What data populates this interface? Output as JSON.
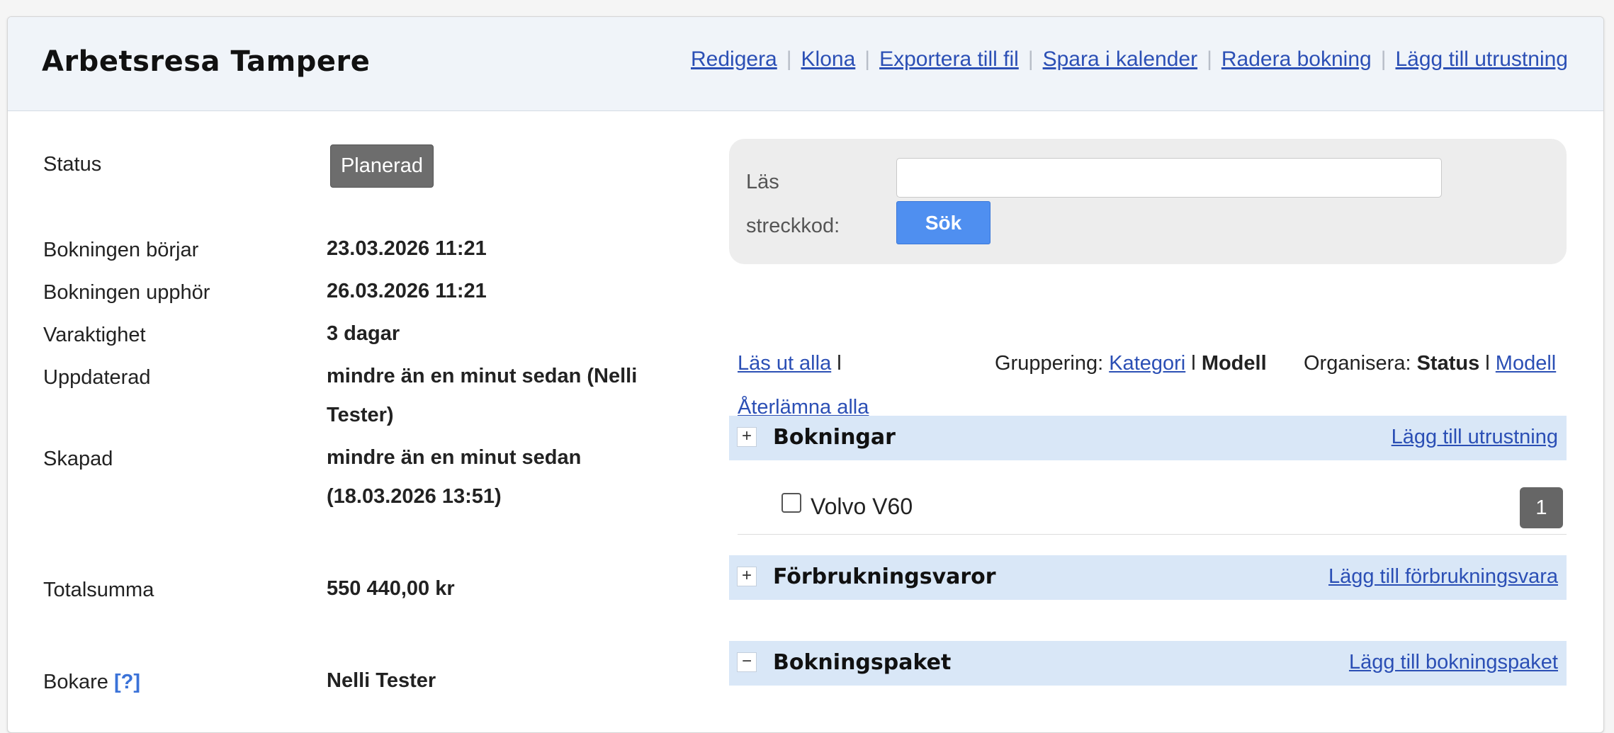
{
  "header": {
    "title": "Arbetsresa Tampere",
    "actions": [
      "Redigera",
      "Klona",
      "Exportera till fil",
      "Spara i kalender",
      "Radera bokning",
      "Lägg till utrustning"
    ]
  },
  "details": {
    "status_label": "Status",
    "status_value": "Planerad",
    "start_label": "Bokningen börjar",
    "start_value": "23.03.2026 11:21",
    "end_label": "Bokningen upphör",
    "end_value": "26.03.2026 11:21",
    "duration_label": "Varaktighet",
    "duration_value": "3 dagar",
    "updated_label": "Uppdaterad",
    "updated_value_line1": "mindre än en minut sedan (Nelli",
    "updated_value_line2": "Tester)",
    "created_label": "Skapad",
    "created_value_line1": "mindre än en minut sedan",
    "created_value_line2": "(18.03.2026 13:51)",
    "total_label": "Totalsumma",
    "total_value": "550 440,00 kr",
    "booker_label": "Bokare",
    "booker_help": "[?]",
    "booker_value": "Nelli Tester"
  },
  "search": {
    "label_line1": "Läs",
    "label_line2": "streckkod:",
    "input_value": "",
    "button_label": "Sök"
  },
  "toolbar": {
    "checkout_all": "Läs ut alla",
    "return_all": "Återlämna alla",
    "pipe": "l",
    "grouping_label": "Gruppering:",
    "grouping_category": "Kategori",
    "grouping_model": "Modell",
    "organize_label": "Organisera:",
    "organize_status": "Status",
    "organize_model": "Modell"
  },
  "sections": [
    {
      "toggle": "+",
      "title": "Bokningar",
      "link": "Lägg till utrustning"
    },
    {
      "toggle": "+",
      "title": "Förbrukningsvaror",
      "link": "Lägg till förbrukningsvara"
    },
    {
      "toggle": "−",
      "title": "Bokningspaket",
      "link": "Lägg till bokningspaket"
    }
  ],
  "items": [
    {
      "name": "Volvo V60",
      "count": "1"
    }
  ]
}
